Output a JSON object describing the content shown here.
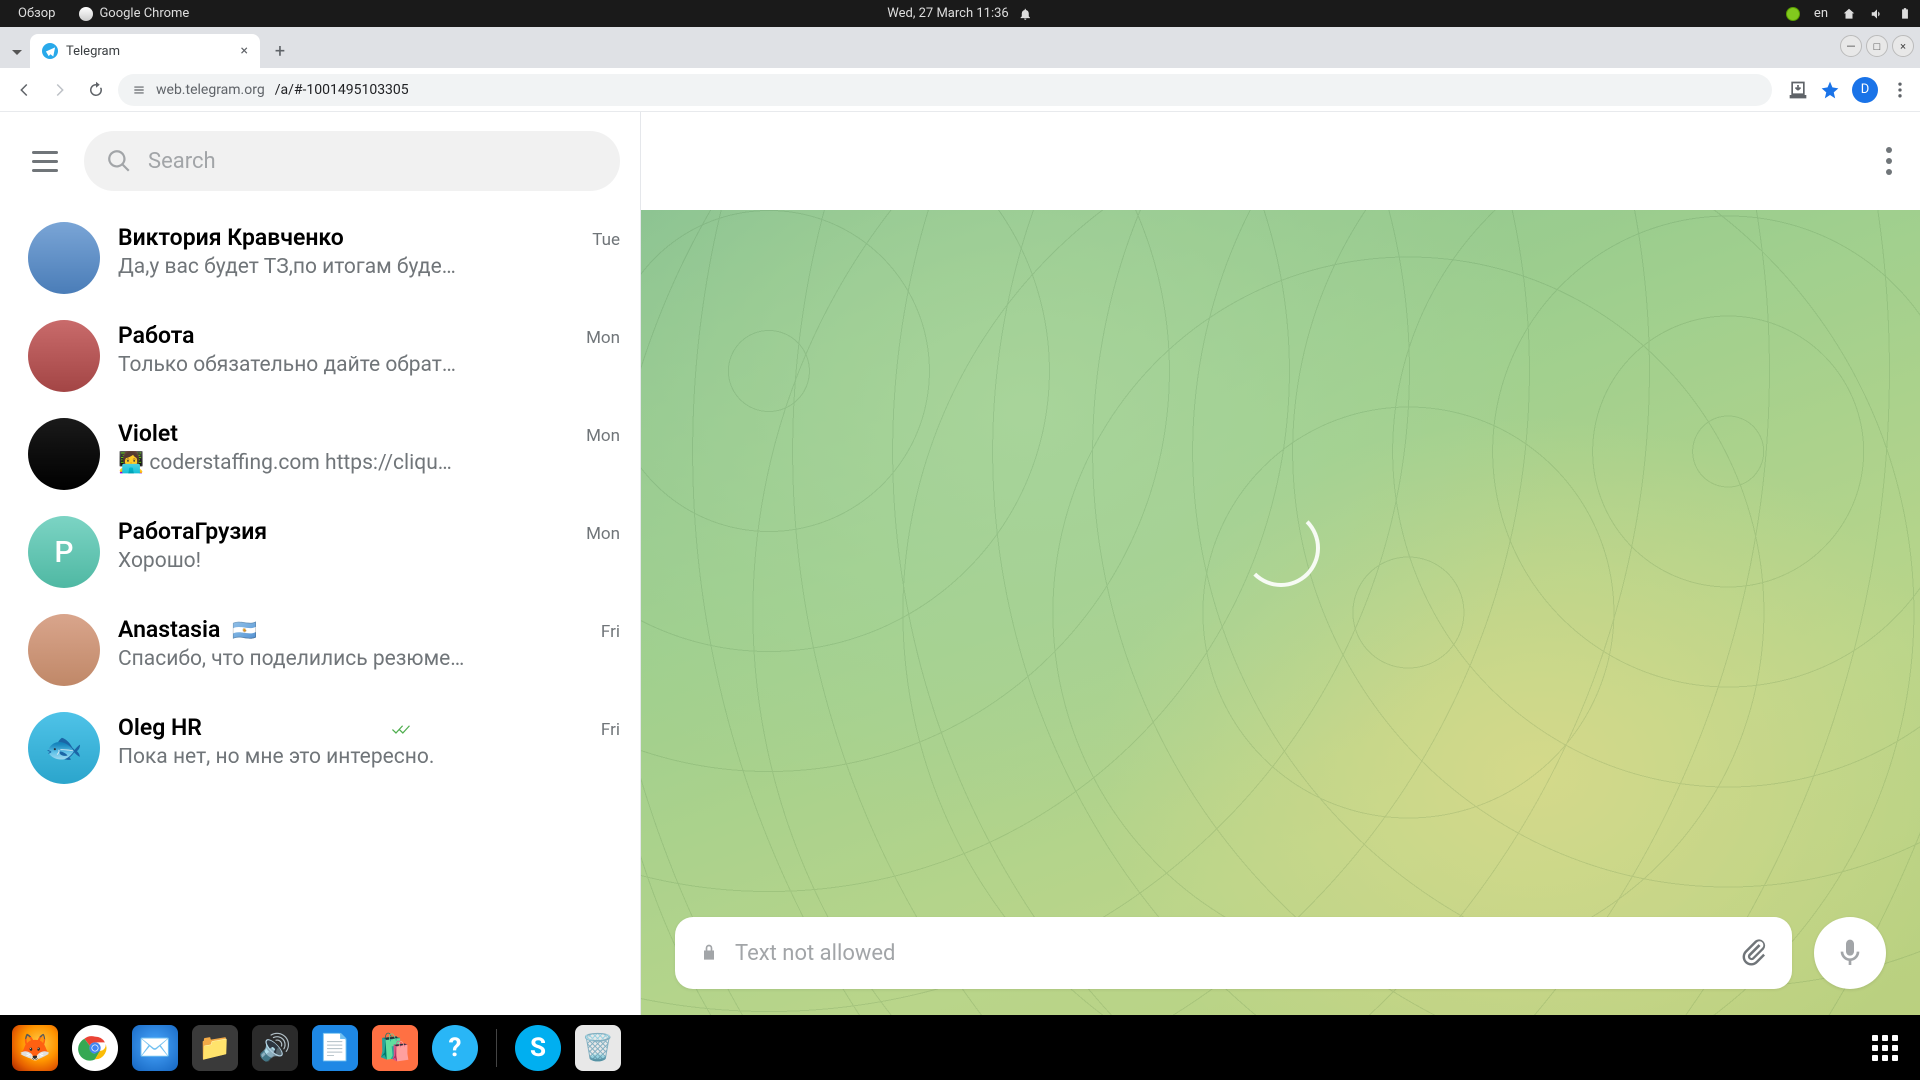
{
  "gnome": {
    "overview": "Обзор",
    "browser": "Google Chrome",
    "datetime": "Wed, 27 March  11:36",
    "lang": "en"
  },
  "browser": {
    "tab_title": "Telegram",
    "url_host": "web.telegram.org",
    "url_path": "/a/#-1001495103305",
    "profile_letter": "D"
  },
  "telegram": {
    "search_placeholder": "Search",
    "composer_placeholder": "Text not allowed",
    "chats": [
      {
        "name": "Виктория Кравченко",
        "date": "Tue",
        "msg": "Да,у вас будет ТЗ,по итогам буде…",
        "avatar_class": "av0",
        "initial": "",
        "read": false,
        "flag": ""
      },
      {
        "name": "Работа",
        "date": "Mon",
        "msg": "Только обязательно дайте обрат…",
        "avatar_class": "av1",
        "initial": "",
        "read": false,
        "flag": ""
      },
      {
        "name": "Violet",
        "date": "Mon",
        "msg": "coderstaffing.com https://cliqu…",
        "avatar_class": "av2",
        "initial": "",
        "read": false,
        "flag": "",
        "prefix_emoji": "👩‍💻"
      },
      {
        "name": "РаботаГрузия",
        "date": "Mon",
        "msg": "Хорошо!",
        "avatar_class": "av3",
        "initial": "Р",
        "read": false,
        "flag": ""
      },
      {
        "name": "Anastasia",
        "date": "Fri",
        "msg": "Спасибо, что поделились резюме…",
        "avatar_class": "av4",
        "initial": "",
        "read": false,
        "flag": "🇦🇷"
      },
      {
        "name": "Oleg HR",
        "date": "Fri",
        "msg": "Пока нет, но мне это интересно.",
        "avatar_class": "av5",
        "initial": "🐟",
        "read": true,
        "flag": ""
      }
    ]
  }
}
